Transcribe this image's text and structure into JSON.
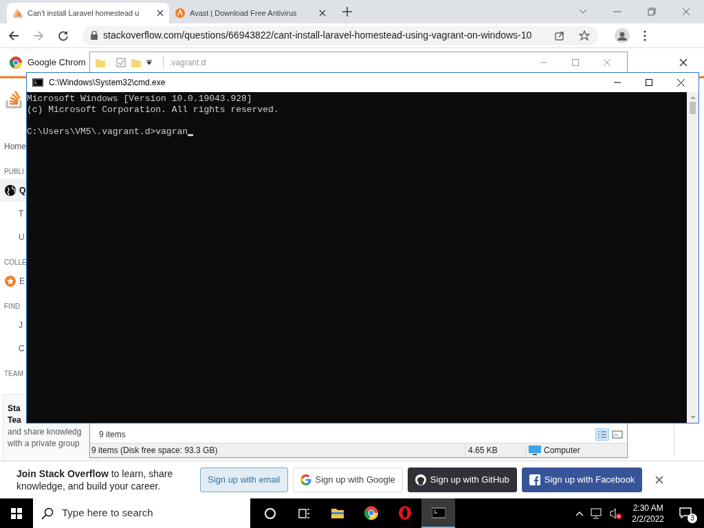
{
  "browser": {
    "tabs": [
      {
        "title": "Can't install Laravel homestead u",
        "selected": true
      },
      {
        "title": "Avast | Download Free Antivirus",
        "selected": false
      }
    ],
    "address": "stackoverflow.com/questions/66943822/cant-install-laravel-homestead-using-vagrant-on-windows-10",
    "infobar": "Google Chrom"
  },
  "sidebar": {
    "items": [
      {
        "kind": "link",
        "text": "Home"
      },
      {
        "kind": "heading",
        "text": "PUBLI"
      },
      {
        "kind": "selected",
        "text": "Q"
      },
      {
        "kind": "sub",
        "text": "T"
      },
      {
        "kind": "sub",
        "text": "U"
      },
      {
        "kind": "heading",
        "text": "COLLE"
      },
      {
        "kind": "star",
        "text": "E"
      },
      {
        "kind": "heading",
        "text": "FIND"
      },
      {
        "kind": "sub",
        "text": "J"
      },
      {
        "kind": "sub",
        "text": "C"
      },
      {
        "kind": "heading",
        "text": "TEAM"
      }
    ],
    "teams_card": {
      "title_lines": [
        "Sta",
        "Tea"
      ],
      "body_lines": [
        "and share knowledg",
        "with a private group"
      ]
    }
  },
  "explorer": {
    "title": ".vagrant.d",
    "item_count": "9 items",
    "status": "9 items (Disk free space: 93.3 GB)",
    "size": "4.65 KB",
    "location": "Computer"
  },
  "cmd": {
    "title": "C:\\Windows\\System32\\cmd.exe",
    "lines": [
      "Microsoft Windows [Version 10.0.19043.928]",
      "(c) Microsoft Corporation. All rights reserved."
    ],
    "prompt": "C:\\Users\\VM5\\.vagrant.d>vagran"
  },
  "join_bar": {
    "text": "**Join Stack Overflow** to learn, share knowledge, and build your career.",
    "buttons": [
      {
        "kind": "email",
        "label": "Sign up with email"
      },
      {
        "kind": "google",
        "label": "Sign up with Google"
      },
      {
        "kind": "github",
        "label": "Sign up with GitHub"
      },
      {
        "kind": "facebook",
        "label": "Sign up with Facebook"
      }
    ]
  },
  "taskbar": {
    "search_placeholder": "Type here to search",
    "apps": [
      {
        "kind": "cortana",
        "selected": false
      },
      {
        "kind": "taskview",
        "selected": false
      },
      {
        "kind": "explorer",
        "selected": false
      },
      {
        "kind": "chrome",
        "selected": false
      },
      {
        "kind": "opera",
        "selected": false
      },
      {
        "kind": "cmd",
        "selected": true
      }
    ],
    "time": "2:30 AM",
    "date": "2/2/2022",
    "notifications": "3"
  }
}
